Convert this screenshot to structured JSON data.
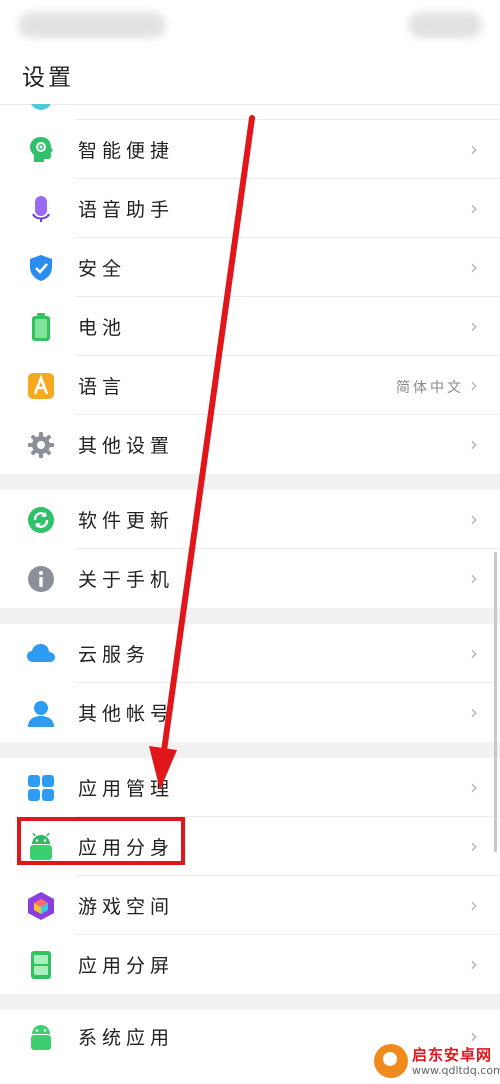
{
  "page": {
    "title": "设置"
  },
  "sections": [
    {
      "items": [
        {
          "id": "smart-assist",
          "label": "智能便捷",
          "icon": "smart-assist-icon",
          "color": "#2fc26b"
        },
        {
          "id": "voice-assistant",
          "label": "语音助手",
          "icon": "microphone-icon",
          "color": "#8d5cf0"
        },
        {
          "id": "security",
          "label": "安全",
          "icon": "shield-icon",
          "color": "#2a8cf0"
        },
        {
          "id": "battery",
          "label": "电池",
          "icon": "battery-icon",
          "color": "#31c35d"
        },
        {
          "id": "language",
          "label": "语言",
          "value": "简体中文",
          "icon": "language-icon",
          "color": "#f6a821"
        },
        {
          "id": "other-settings",
          "label": "其他设置",
          "icon": "gear-icon",
          "color": "#8a8f98"
        }
      ]
    },
    {
      "items": [
        {
          "id": "software-update",
          "label": "软件更新",
          "icon": "update-icon",
          "color": "#2fc26b"
        },
        {
          "id": "about-phone",
          "label": "关于手机",
          "icon": "info-icon",
          "color": "#8a8f98"
        }
      ]
    },
    {
      "items": [
        {
          "id": "cloud-service",
          "label": "云服务",
          "icon": "cloud-icon",
          "color": "#2d9cf2"
        },
        {
          "id": "other-accounts",
          "label": "其他帐号",
          "icon": "account-icon",
          "color": "#2d9cf2"
        }
      ]
    },
    {
      "items": [
        {
          "id": "app-management",
          "label": "应用管理",
          "icon": "app-grid-icon",
          "color": "#2d9cf2"
        },
        {
          "id": "app-clone",
          "label": "应用分身",
          "icon": "android-clone-icon",
          "color": "#3ccf6f"
        },
        {
          "id": "game-space",
          "label": "游戏空间",
          "icon": "game-cube-icon",
          "color": "#8a3fe0"
        },
        {
          "id": "split-screen",
          "label": "应用分屏",
          "icon": "split-screen-icon",
          "color": "#31c35d"
        }
      ]
    },
    {
      "items": [
        {
          "id": "system-apps",
          "label": "系统应用",
          "icon": "android-icon",
          "color": "#3ccf6f"
        }
      ]
    }
  ],
  "chevron": "›",
  "watermark": {
    "name": "启东安卓网",
    "url": "www.qdltdq.com"
  }
}
